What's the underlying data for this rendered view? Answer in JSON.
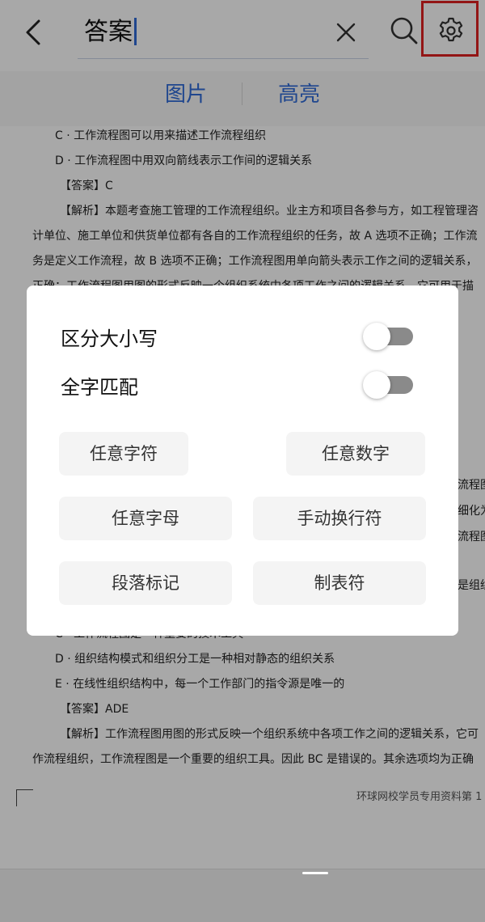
{
  "search": {
    "query": "答案"
  },
  "tabs": [
    {
      "label": "图片"
    },
    {
      "label": "高亮"
    }
  ],
  "document": {
    "lines": [
      "C · 工作流程图可以用来描述工作流程组织",
      "D · 工作流程图中用双向箭线表示工作间的逻辑关系",
      "【答案】C",
      "【解析】本题考查施工管理的工作流程组织。业主方和项目各参与方，如工程管理咨",
      "计单位、施工单位和供货单位都有各自的工作流程组织的任务，故 A 选项不正确；工作流",
      "务是定义工作流程，故 B 选项不正确；工作流程图用单向箭头表示工作之间的逻辑关系，",
      "正确：工作流程图用图的形式反映一个组织系统中各项工作之间的逻辑关系，它可用于描"
    ],
    "lines_lower": [
      "C · 工作流程图是一种重要的技术工具",
      "D · 组织结构模式和组织分工是一种相对静态的组织关系",
      "E · 在线性组织结构中，每一个工作部门的指令源是唯一的",
      "【答案】ADE",
      "【解析】工作流程图用图的形式反映一个组织系统中各项工作之间的逻辑关系，它可",
      "作流程组织，工作流程图是一个重要的组织工具。因此 BC 是错误的。其余选项均为正确"
    ],
    "side_fragments": [
      "流程图",
      "细化为",
      "流程图",
      "是组织"
    ],
    "footer": "环球网校学员专用资料第 1"
  },
  "dialog": {
    "options": [
      {
        "label": "区分大小写",
        "on": false
      },
      {
        "label": "全字匹配",
        "on": false
      }
    ],
    "buttons": [
      {
        "label": "任意字符"
      },
      {
        "label": "任意数字"
      },
      {
        "label": "任意字母"
      },
      {
        "label": "手动换行符"
      },
      {
        "label": "段落标记"
      },
      {
        "label": "制表符"
      }
    ]
  },
  "colors": {
    "accent": "#2f6bd8",
    "highlight_box": "#e02020",
    "toggle_off_track": "#8a8a8a"
  }
}
